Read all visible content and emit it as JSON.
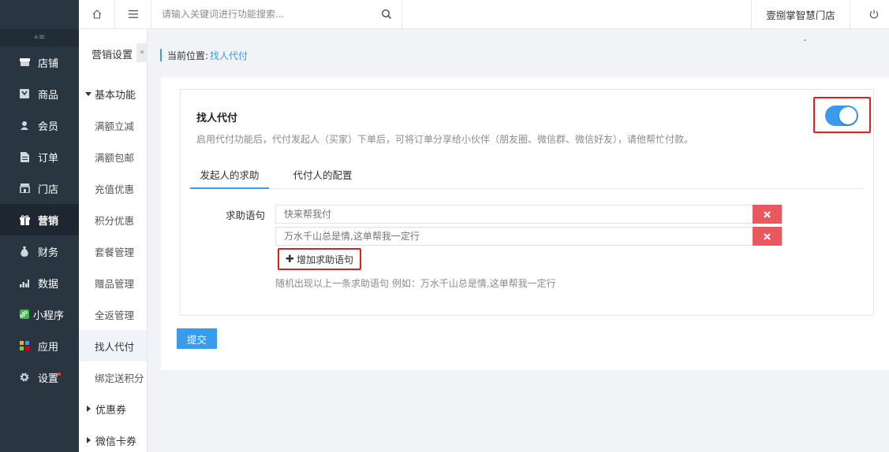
{
  "topbar": {
    "search_placeholder": "请输入关键词进行功能搜索...",
    "store_name": "壹捌掌智慧门店"
  },
  "nav": {
    "collapse_glyph": "«≡",
    "items": [
      {
        "label": "店铺",
        "icon": "store-icon"
      },
      {
        "label": "商品",
        "icon": "goods-icon"
      },
      {
        "label": "会员",
        "icon": "member-icon"
      },
      {
        "label": "订单",
        "icon": "order-icon"
      },
      {
        "label": "门店",
        "icon": "shop-icon"
      },
      {
        "label": "营销",
        "icon": "gift-icon"
      },
      {
        "label": "财务",
        "icon": "finance-icon"
      },
      {
        "label": "数据",
        "icon": "chart-icon"
      },
      {
        "label": "小程序",
        "icon": "miniapp-icon"
      },
      {
        "label": "应用",
        "icon": "apps-icon"
      },
      {
        "label": "设置",
        "icon": "gear-icon"
      }
    ]
  },
  "submenu": {
    "title": "营销设置",
    "fold_glyph": "«",
    "group": "基本功能",
    "items": [
      "满额立减",
      "满额包邮",
      "充值优惠",
      "积分优惠",
      "套餐管理",
      "赠品管理",
      "全返管理",
      "找人代付",
      "绑定送积分"
    ],
    "collapsed_groups": [
      "优惠券",
      "微信卡券"
    ]
  },
  "breadcrumb": {
    "prefix": "当前位置:",
    "current": "找人代付"
  },
  "chevron": "ˇ",
  "feature": {
    "title": "找人代付",
    "description": "启用代付功能后，代付发起人（买家）下单后，可将订单分享给小伙伴（朋友圈、微信群、微信好友），请他帮忙付款。",
    "enabled": true
  },
  "tabs": [
    "发起人的求助",
    "代付人的配置"
  ],
  "help": {
    "label": "求助语句",
    "phrases": [
      "快来帮我付",
      "万水千山总是情,这单帮我一定行"
    ],
    "add_label": "增加求助语句",
    "add_glyph": "✚",
    "hint": "随机出现以上一条求助语句 例如：万水千山总是情,这单帮我一定行"
  },
  "submit_label": "提交",
  "colors": {
    "sidebar": "#2a3542",
    "accent": "#3a9bea",
    "danger": "#e8585f",
    "highlight_frame": "#e02020"
  }
}
